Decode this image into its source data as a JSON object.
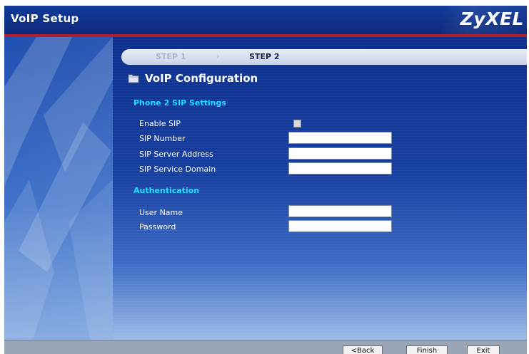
{
  "window": {
    "title": "VoIP Setup",
    "brand": "ZyXEL"
  },
  "steps": {
    "step1": "STEP 1",
    "separator": "›",
    "step2": "STEP 2"
  },
  "section": {
    "title": "VoIP Configuration",
    "icon": "folder-icon"
  },
  "sip_group": {
    "title": "Phone 2 SIP Settings",
    "enable_sip_label": "Enable SIP",
    "enable_sip_checked": false,
    "sip_number_label": "SIP Number",
    "sip_number_value": "",
    "sip_server_address_label": "SIP Server Address",
    "sip_server_address_value": "",
    "sip_service_domain_label": "SIP Service Domain",
    "sip_service_domain_value": ""
  },
  "auth_group": {
    "title": "Authentication",
    "user_name_label": "User Name",
    "user_name_value": "",
    "password_label": "Password",
    "password_value": ""
  },
  "buttons": {
    "back": "<Back",
    "finish": "Finish",
    "exit": "Exit"
  },
  "colors": {
    "title_bar": "#0b2a7c",
    "accent_red": "#b41d2c",
    "group_heading": "#22e0ff",
    "panel_blue": "#0d2f8d"
  }
}
